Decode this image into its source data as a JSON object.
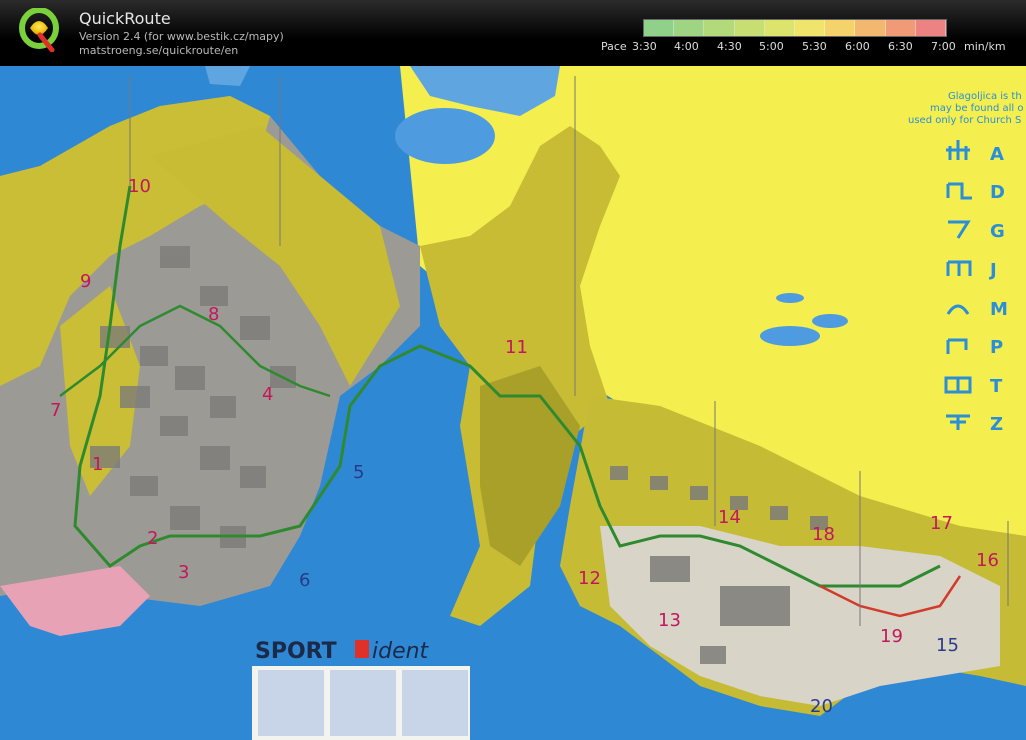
{
  "header": {
    "title": "QuickRoute",
    "version": "Version 2.4  (for www.bestik.cz/mapy)",
    "url": "matstroeng.se/quickroute/en",
    "logo_letter": "Q"
  },
  "pace_scale": {
    "label": "Pace",
    "ticks": [
      "3:30",
      "4:00",
      "4:30",
      "5:00",
      "5:30",
      "6:00",
      "6:30",
      "7:00"
    ],
    "unit": "min/km",
    "colors": [
      "#8fd18a",
      "#9fd582",
      "#b2d97a",
      "#c7de73",
      "#dde46c",
      "#f0e56a",
      "#f4d46a",
      "#f3b86f",
      "#f09a78",
      "#ec8282"
    ]
  },
  "map": {
    "control_numbers": [
      "10",
      "9",
      "8",
      "4",
      "7",
      "1",
      "5",
      "3",
      "6",
      "2",
      "11",
      "14",
      "12",
      "13",
      "18",
      "17",
      "16",
      "19",
      "15",
      "20"
    ],
    "legend_text": [
      "Glagoljica is th",
      "may be found all o",
      "used only for Church S"
    ],
    "glyph_letters": [
      "A",
      "D",
      "G",
      "J",
      "M",
      "P",
      "T",
      "Z"
    ],
    "sponsor": "SPORT",
    "sponsor_suffix": "ident"
  }
}
